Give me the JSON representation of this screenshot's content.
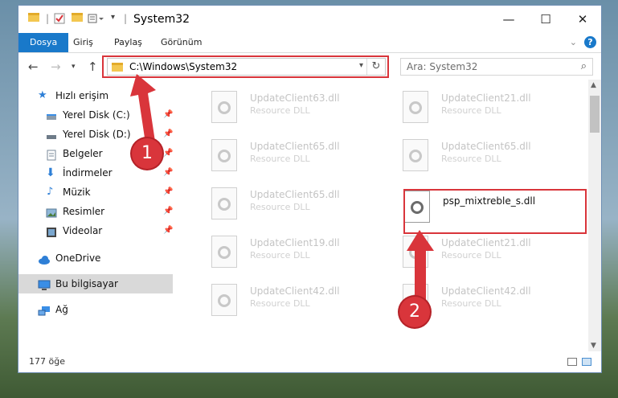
{
  "window": {
    "title": "System32",
    "controls": {
      "minimize": "—",
      "maximize": "☐",
      "close": "✕"
    }
  },
  "ribbon": {
    "tabs": [
      "Dosya",
      "Giriş",
      "Paylaş",
      "Görünüm"
    ],
    "help": "?"
  },
  "address": {
    "path": "C:\\Windows\\System32",
    "search_placeholder": "Ara: System32"
  },
  "nav": {
    "quick_access": "Hızlı erişim",
    "items": [
      {
        "label": "Yerel Disk (C:)",
        "icon": "drive-icon",
        "pinned": true
      },
      {
        "label": "Yerel Disk (D:)",
        "icon": "drive-icon",
        "pinned": true
      },
      {
        "label": "Belgeler",
        "icon": "documents-icon",
        "pinned": true
      },
      {
        "label": "İndirmeler",
        "icon": "download-icon",
        "pinned": true
      },
      {
        "label": "Müzik",
        "icon": "music-icon",
        "pinned": true
      },
      {
        "label": "Resimler",
        "icon": "pictures-icon",
        "pinned": true
      },
      {
        "label": "Videolar",
        "icon": "video-icon",
        "pinned": true
      }
    ],
    "onedrive": "OneDrive",
    "this_pc": "Bu bilgisayar",
    "network": "Ağ"
  },
  "files": [
    {
      "name": "UpdateClient63.dll",
      "type": "Resource DLL"
    },
    {
      "name": "UpdateClient21.dll",
      "type": "Resource DLL"
    },
    {
      "name": "UpdateClient65.dll",
      "type": "Resource DLL"
    },
    {
      "name": "UpdateClient65.dll",
      "type": "Resource DLL"
    },
    {
      "name": "UpdateClient65.dll",
      "type": "Resource DLL"
    },
    {
      "name": "psp_mixtreble_s.dll",
      "type": ""
    },
    {
      "name": "UpdateClient19.dll",
      "type": "Resource DLL"
    },
    {
      "name": "UpdateClient21.dll",
      "type": "Resource DLL"
    },
    {
      "name": "UpdateClient42.dll",
      "type": "Resource DLL"
    },
    {
      "name": "UpdateClient42.dll",
      "type": "Resource DLL"
    }
  ],
  "status": {
    "count": "177 öğe"
  },
  "annotations": {
    "step1": "1",
    "step2": "2"
  },
  "colors": {
    "accent": "#1979ca",
    "highlight": "#d9353b"
  }
}
